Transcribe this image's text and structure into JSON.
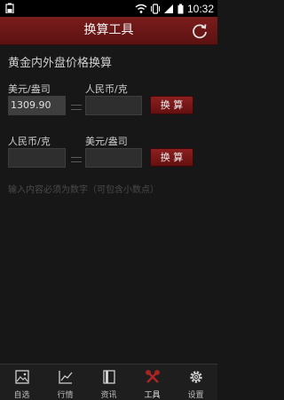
{
  "status_bar": {
    "time": "10:32"
  },
  "header": {
    "title": "换算工具"
  },
  "converter": {
    "section_title": "黄金内外盘价格换算",
    "row1": {
      "left_label": "美元/盎司",
      "left_value": "1309.90",
      "right_label": "人民币/克",
      "right_value": "",
      "button_label": "换 算"
    },
    "row2": {
      "left_label": "人民币/克",
      "left_value": "",
      "right_label": "美元/盎司",
      "right_value": "",
      "button_label": "换 算"
    },
    "hint": "输入内容必须为数字（可包含小数点）"
  },
  "tabs": [
    {
      "label": "自选",
      "icon": "image-icon"
    },
    {
      "label": "行情",
      "icon": "trend-chart-icon"
    },
    {
      "label": "资讯",
      "icon": "book-icon"
    },
    {
      "label": "工具",
      "icon": "tools-icon",
      "active": true
    },
    {
      "label": "设置",
      "icon": "gear-icon"
    }
  ],
  "colors": {
    "accent": "#6e1818",
    "background": "#171717"
  }
}
